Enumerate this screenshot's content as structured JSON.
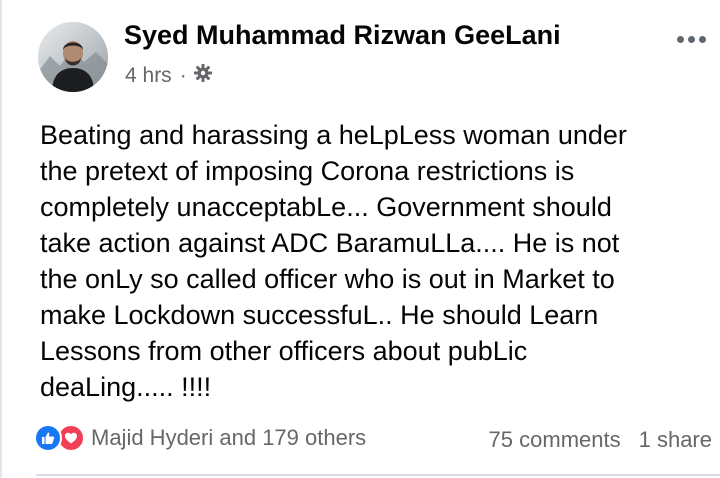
{
  "post": {
    "author": "Syed Muhammad Rizwan GeeLani",
    "time": "4 hrs",
    "separator": "·",
    "audience_icon": "gear-icon",
    "more_icon": "more-options-icon",
    "text": "Beating and harassing a heLpLess woman under\nthe pretext of imposing Corona restrictions is\ncompletely unacceptabLe... Government should\ntake action against ADC BaramuLLa.... He is not\nthe onLy so called officer who is out in Market to\nmake Lockdown successfuL.. He should Learn\nLessons from other officers about pubLic\ndeaLing..... !!!!"
  },
  "footer": {
    "reactions_icons": [
      "like-icon",
      "love-icon"
    ],
    "reactions_text": "Majid Hyderi and 179 others",
    "comments": "75 comments",
    "shares": "1 share"
  },
  "colors": {
    "like": "#1877f2",
    "love": "#f33e58",
    "secondary_text": "#65676b",
    "primary_text": "#050505"
  }
}
